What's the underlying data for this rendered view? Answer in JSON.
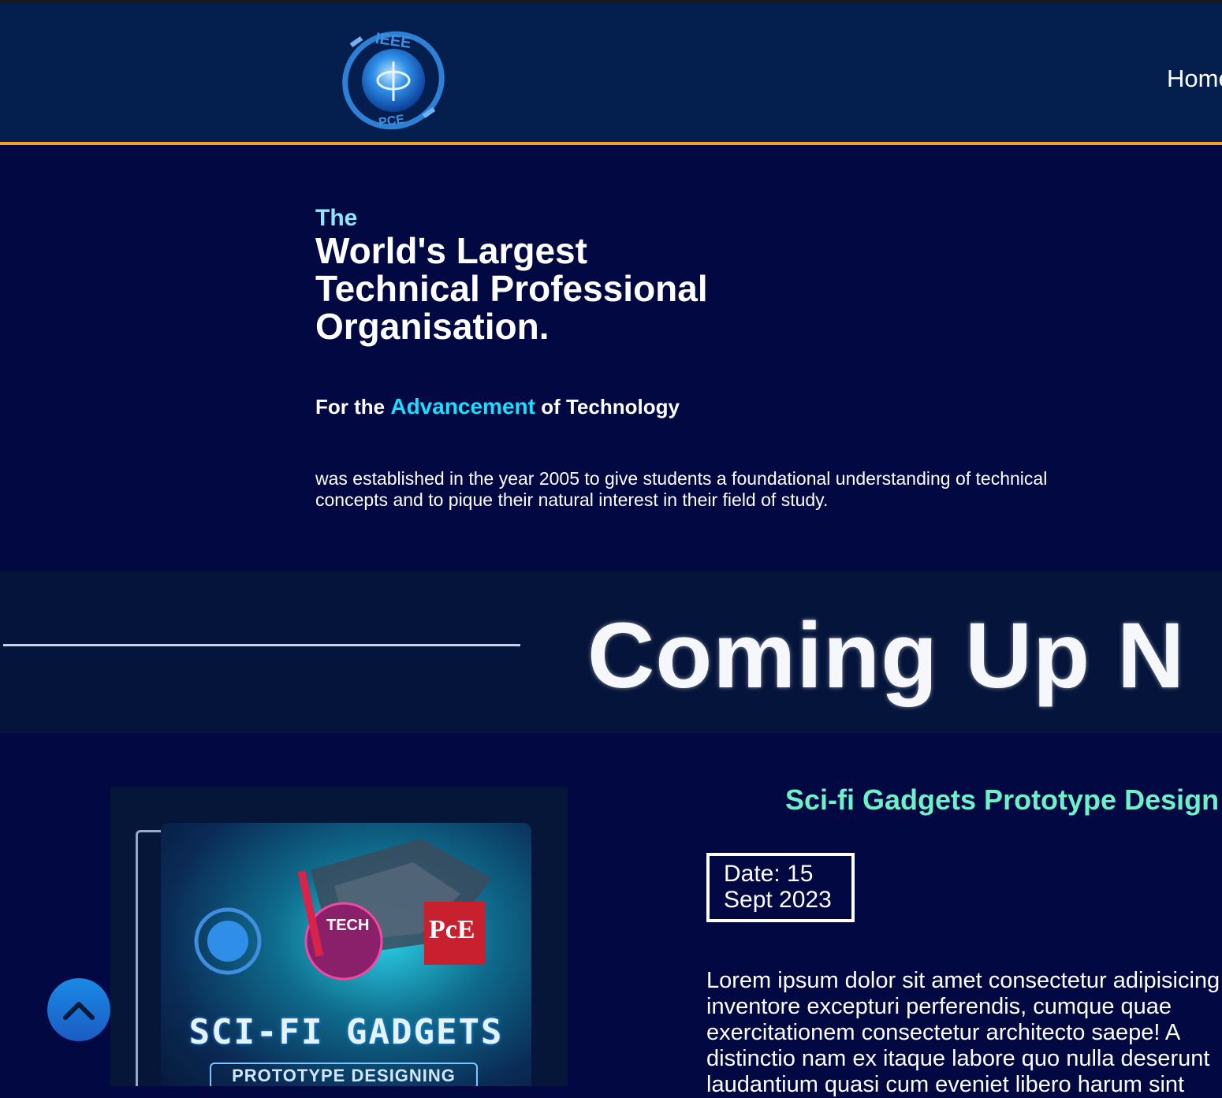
{
  "header": {
    "logo_text_top": "IEEE",
    "logo_text_bottom": "PCE",
    "nav": {
      "home_label": "Home"
    }
  },
  "hero": {
    "the": "The",
    "title_lines": [
      "World's Largest",
      "Technical Professional",
      "Organisation."
    ],
    "tagline_before": "For the ",
    "tagline_accent": "Advancement",
    "tagline_after": " of Technology",
    "description": "was established in the year 2005 to give students a foundational understanding of technical concepts and to pique their natural interest in their field of study."
  },
  "coming_up": {
    "heading": "Coming Up N"
  },
  "event": {
    "title": "Sci-fi Gadgets Prototype Design",
    "date_line1": "Date: 15",
    "date_line2": "Sept 2023",
    "description_lines": [
      "Lorem ipsum dolor sit amet consectetur adipisicing",
      "inventore excepturi perferendis, cumque quae",
      "exercitationem consectetur architecto saepe! A",
      "distinctio nam ex itaque labore quo nulla deserunt",
      "laudantium quasi cum eveniet libero harum sint"
    ],
    "poster": {
      "title": "SCI-FI GADGETS",
      "subtitle": "PROTOTYPE DESIGNING",
      "badge_tech": "TECH",
      "badge_pce": "PcE"
    }
  },
  "colors": {
    "page_bg": "#020842",
    "header_bg": "#041f4d",
    "header_border": "#f0a623",
    "accent_cyan": "#18e0ff",
    "event_title": "#6df2c8",
    "scroll_button": "#1a8ae6"
  },
  "icons": {
    "scroll_top": "chevron-up-icon",
    "logo": "ieee-pce-logo"
  }
}
